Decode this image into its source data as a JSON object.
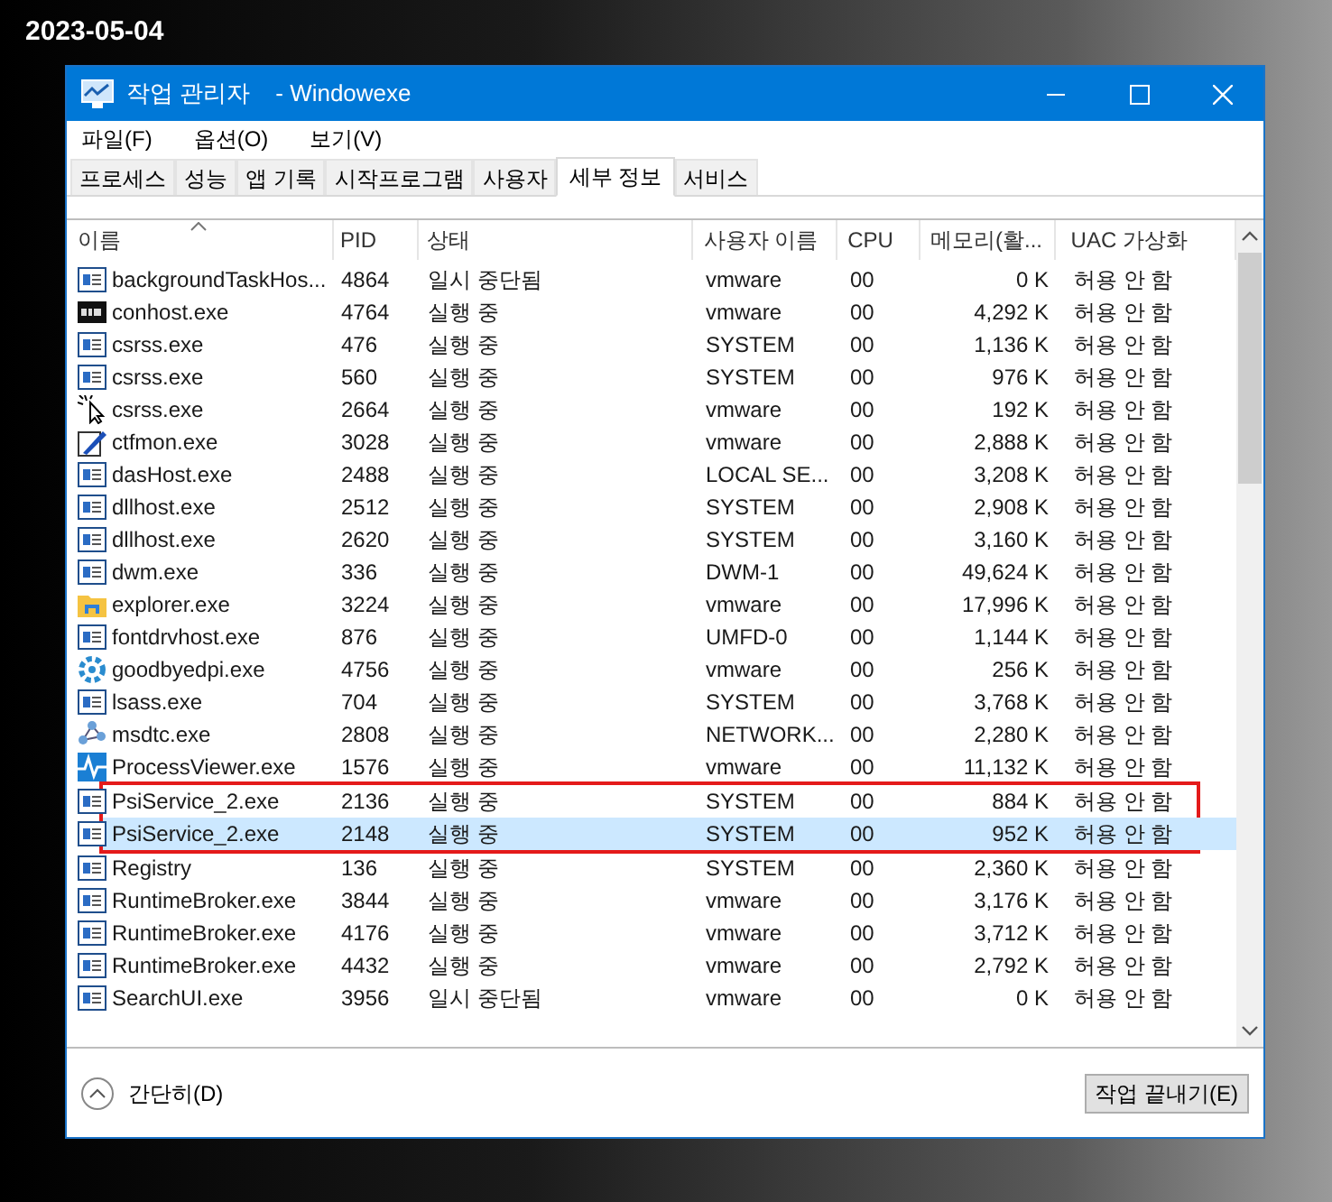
{
  "date": "2023-05-04",
  "window": {
    "title": "작업 관리자",
    "subtitle": "- Windowexe"
  },
  "menu": [
    "파일(F)",
    "옵션(O)",
    "보기(V)"
  ],
  "tabs": [
    {
      "label": "프로세스",
      "selected": false
    },
    {
      "label": "성능",
      "selected": false
    },
    {
      "label": "앱 기록",
      "selected": false
    },
    {
      "label": "시작프로그램",
      "selected": false
    },
    {
      "label": "사용자",
      "selected": false
    },
    {
      "label": "세부 정보",
      "selected": true
    },
    {
      "label": "서비스",
      "selected": false
    }
  ],
  "columns": [
    {
      "label": "이름",
      "sorted": true
    },
    {
      "label": "PID",
      "sorted": false
    },
    {
      "label": "상태",
      "sorted": false
    },
    {
      "label": "사용자 이름",
      "sorted": false
    },
    {
      "label": "CPU",
      "sorted": false
    },
    {
      "label": "메모리(활...",
      "sorted": false
    },
    {
      "label": "UAC 가상화",
      "sorted": false
    }
  ],
  "rows": [
    {
      "kind": "window",
      "name": "backgroundTaskHos...",
      "pid": "4864",
      "status": "일시 중단됨",
      "user": "vmware",
      "cpu": "00",
      "memory": "0 K",
      "uac": "허용 안 함",
      "selected": false,
      "marked": false
    },
    {
      "kind": "console",
      "name": "conhost.exe",
      "pid": "4764",
      "status": "실행 중",
      "user": "vmware",
      "cpu": "00",
      "memory": "4,292 K",
      "uac": "허용 안 함",
      "selected": false,
      "marked": false
    },
    {
      "kind": "window",
      "name": "csrss.exe",
      "pid": "476",
      "status": "실행 중",
      "user": "SYSTEM",
      "cpu": "00",
      "memory": "1,136 K",
      "uac": "허용 안 함",
      "selected": false,
      "marked": false
    },
    {
      "kind": "window",
      "name": "csrss.exe",
      "pid": "560",
      "status": "실행 중",
      "user": "SYSTEM",
      "cpu": "00",
      "memory": "976 K",
      "uac": "허용 안 함",
      "selected": false,
      "marked": false
    },
    {
      "kind": "cursor",
      "name": "csrss.exe",
      "pid": "2664",
      "status": "실행 중",
      "user": "vmware",
      "cpu": "00",
      "memory": "192 K",
      "uac": "허용 안 함",
      "selected": false,
      "marked": false
    },
    {
      "kind": "pen",
      "name": "ctfmon.exe",
      "pid": "3028",
      "status": "실행 중",
      "user": "vmware",
      "cpu": "00",
      "memory": "2,888 K",
      "uac": "허용 안 함",
      "selected": false,
      "marked": false
    },
    {
      "kind": "window",
      "name": "dasHost.exe",
      "pid": "2488",
      "status": "실행 중",
      "user": "LOCAL SE...",
      "cpu": "00",
      "memory": "3,208 K",
      "uac": "허용 안 함",
      "selected": false,
      "marked": false
    },
    {
      "kind": "window",
      "name": "dllhost.exe",
      "pid": "2512",
      "status": "실행 중",
      "user": "SYSTEM",
      "cpu": "00",
      "memory": "2,908 K",
      "uac": "허용 안 함",
      "selected": false,
      "marked": false
    },
    {
      "kind": "window",
      "name": "dllhost.exe",
      "pid": "2620",
      "status": "실행 중",
      "user": "SYSTEM",
      "cpu": "00",
      "memory": "3,160 K",
      "uac": "허용 안 함",
      "selected": false,
      "marked": false
    },
    {
      "kind": "window",
      "name": "dwm.exe",
      "pid": "336",
      "status": "실행 중",
      "user": "DWM-1",
      "cpu": "00",
      "memory": "49,624 K",
      "uac": "허용 안 함",
      "selected": false,
      "marked": false
    },
    {
      "kind": "folder",
      "name": "explorer.exe",
      "pid": "3224",
      "status": "실행 중",
      "user": "vmware",
      "cpu": "00",
      "memory": "17,996 K",
      "uac": "허용 안 함",
      "selected": false,
      "marked": false
    },
    {
      "kind": "window",
      "name": "fontdrvhost.exe",
      "pid": "876",
      "status": "실행 중",
      "user": "UMFD-0",
      "cpu": "00",
      "memory": "1,144 K",
      "uac": "허용 안 함",
      "selected": false,
      "marked": false
    },
    {
      "kind": "gear",
      "name": "goodbyedpi.exe",
      "pid": "4756",
      "status": "실행 중",
      "user": "vmware",
      "cpu": "00",
      "memory": "256 K",
      "uac": "허용 안 함",
      "selected": false,
      "marked": false
    },
    {
      "kind": "window",
      "name": "lsass.exe",
      "pid": "704",
      "status": "실행 중",
      "user": "SYSTEM",
      "cpu": "00",
      "memory": "3,768 K",
      "uac": "허용 안 함",
      "selected": false,
      "marked": false
    },
    {
      "kind": "network",
      "name": "msdtc.exe",
      "pid": "2808",
      "status": "실행 중",
      "user": "NETWORK...",
      "cpu": "00",
      "memory": "2,280 K",
      "uac": "허용 안 함",
      "selected": false,
      "marked": false
    },
    {
      "kind": "pulse",
      "name": "ProcessViewer.exe",
      "pid": "1576",
      "status": "실행 중",
      "user": "vmware",
      "cpu": "00",
      "memory": "11,132 K",
      "uac": "허용 안 함",
      "selected": false,
      "marked": false
    },
    {
      "kind": "window",
      "name": "PsiService_2.exe",
      "pid": "2136",
      "status": "실행 중",
      "user": "SYSTEM",
      "cpu": "00",
      "memory": "884 K",
      "uac": "허용 안 함",
      "selected": false,
      "marked": true
    },
    {
      "kind": "window",
      "name": "PsiService_2.exe",
      "pid": "2148",
      "status": "실행 중",
      "user": "SYSTEM",
      "cpu": "00",
      "memory": "952 K",
      "uac": "허용 안 함",
      "selected": true,
      "marked": true
    },
    {
      "kind": "window",
      "name": "Registry",
      "pid": "136",
      "status": "실행 중",
      "user": "SYSTEM",
      "cpu": "00",
      "memory": "2,360 K",
      "uac": "허용 안 함",
      "selected": false,
      "marked": false
    },
    {
      "kind": "window",
      "name": "RuntimeBroker.exe",
      "pid": "3844",
      "status": "실행 중",
      "user": "vmware",
      "cpu": "00",
      "memory": "3,176 K",
      "uac": "허용 안 함",
      "selected": false,
      "marked": false
    },
    {
      "kind": "window",
      "name": "RuntimeBroker.exe",
      "pid": "4176",
      "status": "실행 중",
      "user": "vmware",
      "cpu": "00",
      "memory": "3,712 K",
      "uac": "허용 안 함",
      "selected": false,
      "marked": false
    },
    {
      "kind": "window",
      "name": "RuntimeBroker.exe",
      "pid": "4432",
      "status": "실행 중",
      "user": "vmware",
      "cpu": "00",
      "memory": "2,792 K",
      "uac": "허용 안 함",
      "selected": false,
      "marked": false
    },
    {
      "kind": "window",
      "name": "SearchUI.exe",
      "pid": "3956",
      "status": "일시 중단됨",
      "user": "vmware",
      "cpu": "00",
      "memory": "0 K",
      "uac": "허용 안 함",
      "selected": false,
      "marked": false
    }
  ],
  "footer": {
    "collapse": "간단히(D)",
    "end_task": "작업 끝내기(E)"
  }
}
